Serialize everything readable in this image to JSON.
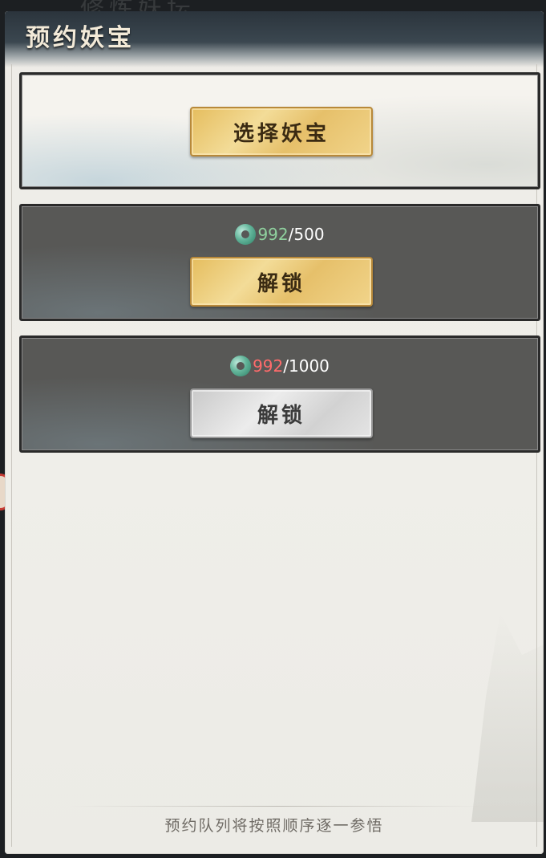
{
  "background_text": "修炼妖坛",
  "panel": {
    "title": "预约妖宝"
  },
  "slots": [
    {
      "button_label": "选择妖宝",
      "button_style": "gold"
    },
    {
      "cost_have": "992",
      "cost_need": "/500",
      "currency_icon": "jade-ring-icon",
      "button_label": "解锁",
      "button_style": "gold",
      "affordable": true
    },
    {
      "cost_have": "992",
      "cost_need": "/1000",
      "currency_icon": "jade-ring-icon",
      "button_label": "解锁",
      "button_style": "gray",
      "affordable": false
    }
  ],
  "footer": {
    "hint": "预约队列将按照顺序逐一参悟"
  },
  "colors": {
    "gold_button": "#e5bd5e",
    "gray_button": "#d2d2d2",
    "affordable": "#8fd19e",
    "unaffordable": "#ff6b6b",
    "dark_card": "#585856"
  }
}
